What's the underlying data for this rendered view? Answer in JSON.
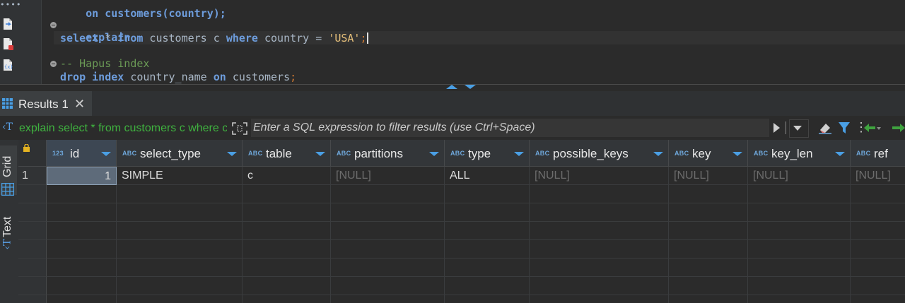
{
  "editor": {
    "line_top": "on customers(country);",
    "line_explain": "explain",
    "current_line": {
      "kw_select": "select",
      "star": " * ",
      "kw_from": "from",
      "mid": " customers c ",
      "kw_where": "where",
      "cond": " country = ",
      "str": "'USA'",
      "semi": ";"
    },
    "comment": "-- Hapus index",
    "drop_line": {
      "kw_drop": "drop",
      "kw_index": "index",
      "name": " country_name ",
      "kw_on": "on",
      "table": " customers",
      "semi": ";"
    }
  },
  "results_tab": {
    "title": "Results 1",
    "close": "✕"
  },
  "filter_bar": {
    "query_text": "explain select * from customers c where country = 'USA'",
    "placeholder": "Enter a SQL expression to filter results (use Ctrl+Space)"
  },
  "side_panel": {
    "grid_label": "Grid",
    "text_label": "Text"
  },
  "table": {
    "type_abc": "ABC",
    "type_123": "123",
    "columns": [
      "id",
      "select_type",
      "table",
      "partitions",
      "type",
      "possible_keys",
      "key",
      "key_len",
      "ref"
    ],
    "rows": [
      {
        "num": "1",
        "id": "1",
        "select_type": "SIMPLE",
        "table": "c",
        "partitions": "[NULL]",
        "type": "ALL",
        "possible_keys": "[NULL]",
        "key": "[NULL]",
        "key_len": "[NULL]",
        "ref": "[NULL]"
      }
    ]
  },
  "colors": {
    "keyword": "#6d9cdb",
    "string": "#e6c07b",
    "comment": "#6a9955",
    "query_green": "#3fb23f",
    "accent_blue": "#4a9fe4"
  }
}
